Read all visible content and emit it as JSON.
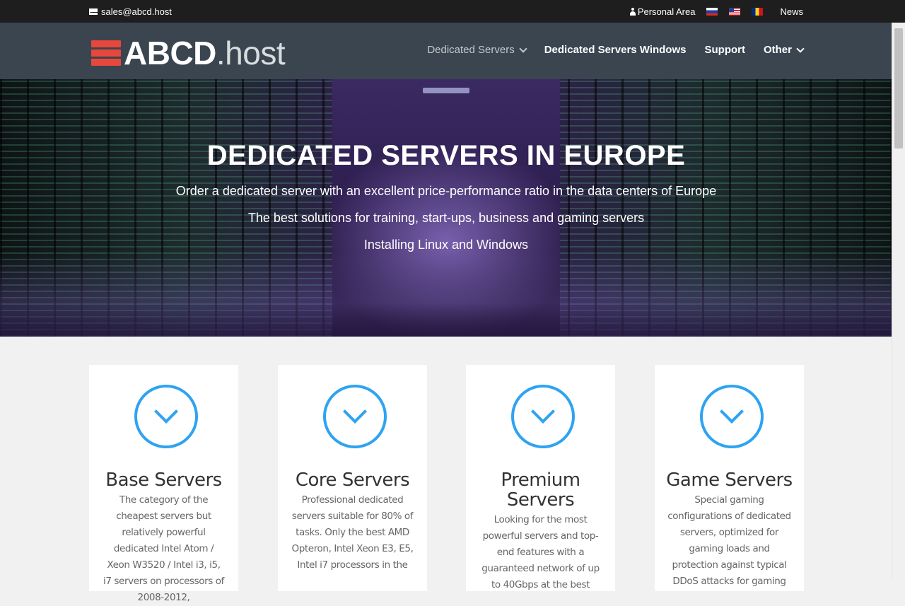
{
  "topbar": {
    "email": "sales@abcd.host",
    "personal_area": "Personal Area",
    "news": "News",
    "flags": [
      "ru-flag",
      "us-flag",
      "ro-flag"
    ]
  },
  "header": {
    "logo_main": "ABCD",
    "logo_suffix": ".host",
    "nav": [
      {
        "label": "Dedicated Servers",
        "has_dropdown": true
      },
      {
        "label": "Dedicated Servers Windows",
        "has_dropdown": false
      },
      {
        "label": "Support",
        "has_dropdown": false
      },
      {
        "label": "Other",
        "has_dropdown": true
      }
    ]
  },
  "hero": {
    "title": "DEDICATED SERVERS IN EUROPE",
    "line1": "Order a dedicated server with an excellent price-performance ratio in the data centers of Europe",
    "line2": "The best solutions for training, start-ups, business and gaming servers",
    "line3": "Installing Linux and Windows"
  },
  "cards": [
    {
      "title": "Base Servers",
      "text": "The category of the cheapest servers but relatively powerful dedicated Intel Atom / Xeon W3520 / Intel i3, i5, i7 servers on processors of 2008-2012,"
    },
    {
      "title": "Core Servers",
      "text": "Professional dedicated servers suitable for 80% of tasks. Only the best AMD Opteron, Intel Xeon E3, E5, Intel i7 processors in the"
    },
    {
      "title": "Premium Servers",
      "text": "Looking for the most powerful servers and top-end features with a guaranteed network of up to 40Gbps at the best"
    },
    {
      "title": "Game Servers",
      "text": "Special gaming configurations of dedicated servers, optimized for gaming loads and protection against typical DDoS attacks for gaming"
    }
  ],
  "colors": {
    "accent": "#2ea3f2",
    "header_bg": "#3a4550",
    "topbar_bg": "#1e1e1e",
    "logo_red": "#e8473c"
  }
}
